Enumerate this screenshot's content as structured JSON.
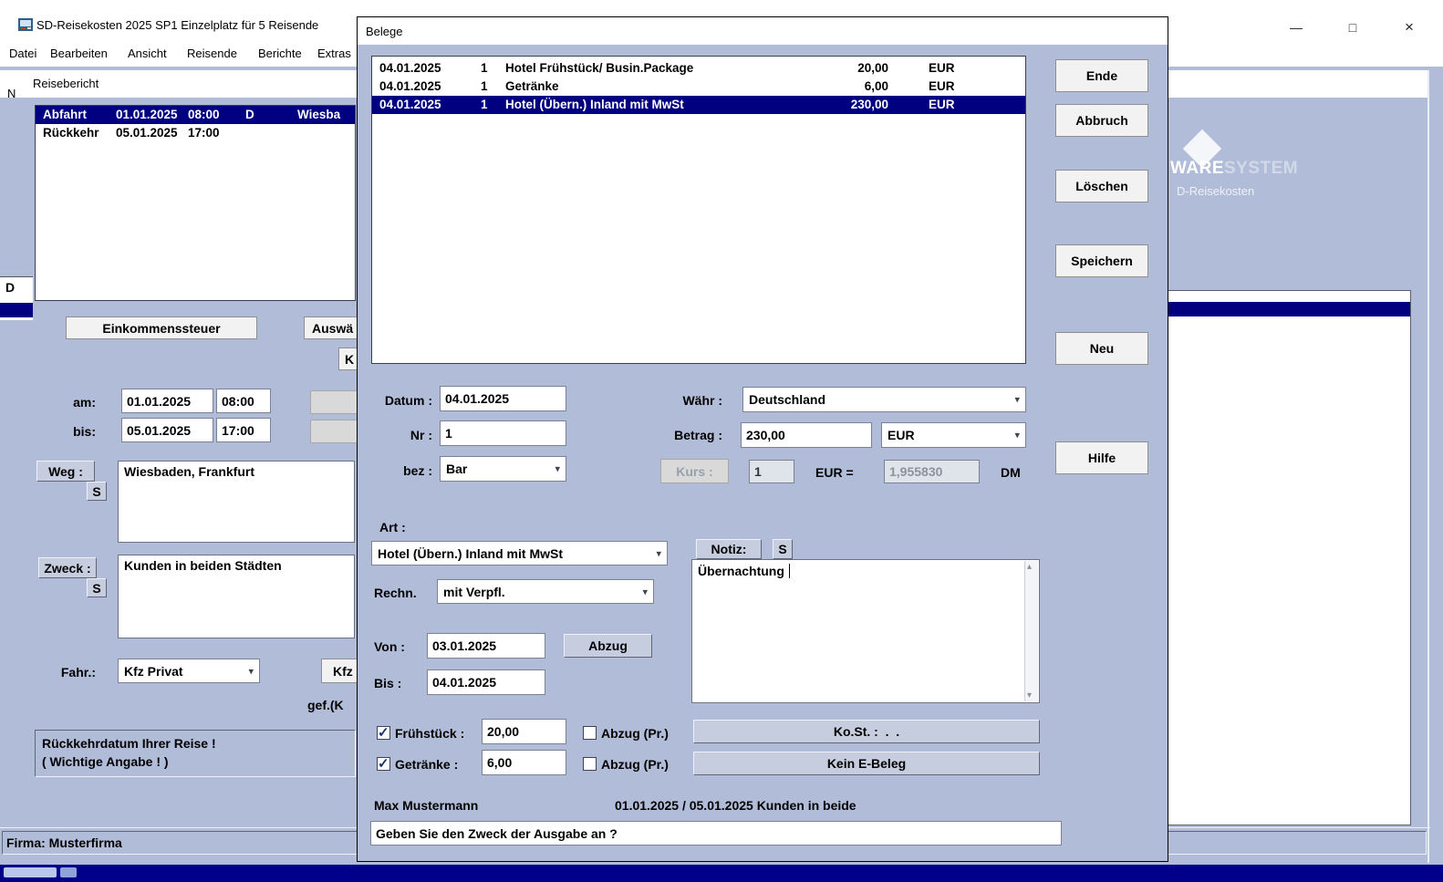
{
  "icons": {
    "check": "✓",
    "chevron_down": "▾",
    "scroll_up": "▴",
    "scroll_down": "▾",
    "minimize": "—",
    "maximize": "□",
    "close": "×"
  },
  "main_window": {
    "title": "SD-Reisekosten 2025 SP1 Einzelplatz für 5 Reisende",
    "menu_items": [
      "Datei",
      "Bearbeiten",
      "Ansicht",
      "Reisende",
      "Berichte",
      "Extras"
    ],
    "firma_status": "Firma: Musterfirma",
    "fragment_n": "N"
  },
  "logo": {
    "line1_a": "WARE",
    "line1_b": "SYSTEM",
    "line2": "D-Reisekosten"
  },
  "reisebericht": {
    "title": "Reisebericht",
    "fragment_d": "D",
    "trips": [
      {
        "label": "Abfahrt",
        "date": "01.01.2025",
        "time": "08:00",
        "country": "D",
        "city": "Wiesba"
      },
      {
        "label": "Rückkehr",
        "date": "05.01.2025",
        "time": "17:00",
        "country": "",
        "city": ""
      }
    ],
    "einkommenssteuer_button": "Einkommenssteuer",
    "auswahl_button": "Auswä",
    "k_button": "K",
    "am_label": "am:",
    "am_date": "01.01.2025",
    "am_time": "08:00",
    "bis_label": "bis:",
    "bis_date": "05.01.2025",
    "bis_time": "17:00",
    "weg_button": "Weg :",
    "weg_s_button": "S",
    "weg_text": "Wiesbaden, Frankfurt",
    "zweck_button": "Zweck :",
    "zweck_s_button": "S",
    "zweck_text": "Kunden in beiden Städten",
    "fahr_label": "Fahr.:",
    "fahr_value": "Kfz Privat",
    "kfz_button": "Kfz",
    "gef_label": "gef.(K",
    "hint_line1": "Rückkehrdatum Ihrer Reise !",
    "hint_line2": "( Wichtige Angabe ! )"
  },
  "belege": {
    "title": "Belege",
    "rows": [
      {
        "date": "04.01.2025",
        "nr": "1",
        "text": "Hotel Frühstück/ Busin.Package",
        "amount": "20,00",
        "cur": "EUR"
      },
      {
        "date": "04.01.2025",
        "nr": "1",
        "text": "Getränke",
        "amount": "6,00",
        "cur": "EUR"
      },
      {
        "date": "04.01.2025",
        "nr": "1",
        "text": "Hotel (Übern.) Inland mit MwSt",
        "amount": "230,00",
        "cur": "EUR"
      }
    ],
    "buttons": {
      "ende": "Ende",
      "abbruch": "Abbruch",
      "loeschen": "Löschen",
      "speichern": "Speichern",
      "neu": "Neu",
      "hilfe": "Hilfe"
    },
    "form": {
      "datum_label": "Datum :",
      "datum_value": "04.01.2025",
      "waehr_label": "Währ :",
      "waehr_value": "Deutschland",
      "nr_label": "Nr :",
      "nr_value": "1",
      "betrag_label": "Betrag :",
      "betrag_value": "230,00",
      "betrag_currency": "EUR",
      "bez_label": "bez :",
      "bez_value": "Bar",
      "kurs_label": "Kurs :",
      "kurs_value": "1",
      "kurs_eq": "EUR =",
      "kurs_rate": "1,955830",
      "kurs_dm": "DM",
      "art_label": "Art :",
      "art_value": "Hotel (Übern.) Inland mit MwSt",
      "notiz_button": "Notiz:",
      "notiz_s_button": "S",
      "rechn_label": "Rechn.",
      "rechn_value": "mit Verpfl.",
      "notiz_text": "Übernachtung",
      "von_label": "Von :",
      "von_value": "03.01.2025",
      "abzug_button": "Abzug",
      "bis_label": "Bis :",
      "bis_value": "04.01.2025",
      "fruehstueck_label": "Frühstück :",
      "fruehstueck_value": "20,00",
      "abzug_pr1": "Abzug (Pr.)",
      "getraenke_label": "Getränke :",
      "getraenke_value": "6,00",
      "abzug_pr2": "Abzug (Pr.)",
      "kost_button": "Ko.St. :  .  .",
      "ebeleg_button": "Kein E-Beleg",
      "person": "Max Mustermann",
      "trip_info": "01.01.2025 / 05.01.2025 Kunden in beide",
      "status": "Geben Sie den Zweck der Ausgabe an ?"
    }
  }
}
